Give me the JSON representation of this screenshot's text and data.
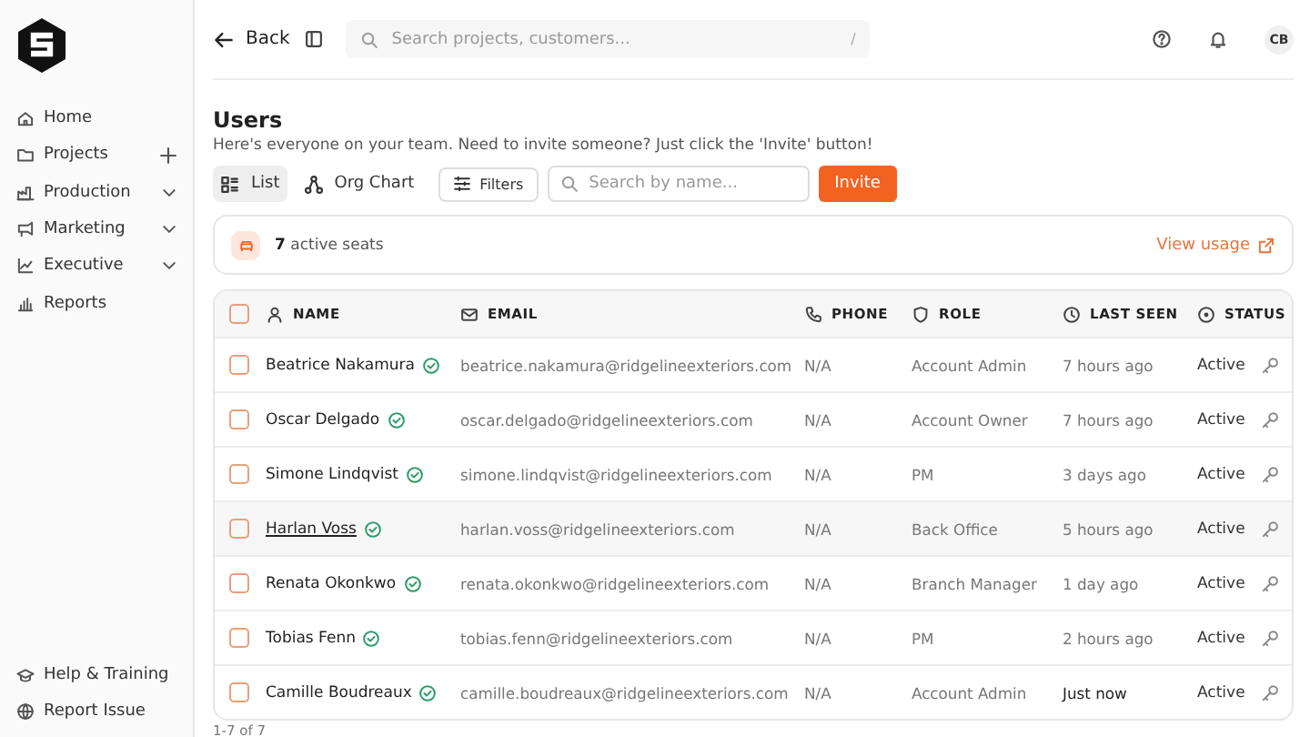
{
  "sidebar": {
    "items": [
      {
        "label": "Home",
        "kind": "link",
        "selected": false
      },
      {
        "label": "Projects",
        "kind": "addable",
        "selected": false
      },
      {
        "label": "Production",
        "kind": "group",
        "selected": false
      },
      {
        "label": "Marketing",
        "kind": "group",
        "selected": false
      },
      {
        "label": "Executive",
        "kind": "group",
        "selected": false
      },
      {
        "label": "Reports",
        "kind": "link",
        "selected": false
      }
    ],
    "footer_items": [
      {
        "label": "Help & Training"
      },
      {
        "label": "Report Issue"
      }
    ]
  },
  "topbar": {
    "back": "Back",
    "search": {
      "placeholder": "Search projects, customers...",
      "shortcut": "/"
    },
    "avatar": "CB"
  },
  "page": {
    "title": "Users",
    "subtitle": "Here's everyone on your team. Need to invite someone? Just click the 'Invite' button!",
    "views": [
      {
        "label": "List",
        "selected": true
      },
      {
        "label": "Org Chart",
        "selected": false
      }
    ],
    "filters": "Filters",
    "search": {
      "placeholder": "Search by name..."
    },
    "invite": "Invite"
  },
  "seats": {
    "count": "7",
    "label": "active seats",
    "link": "View usage"
  },
  "table": {
    "all_checked": false,
    "columns": [
      {
        "label": "NAME"
      },
      {
        "label": "EMAIL"
      },
      {
        "label": "PHONE"
      },
      {
        "label": "ROLE"
      },
      {
        "label": "LAST SEEN"
      },
      {
        "label": "STATUS"
      }
    ],
    "rows": [
      {
        "name": "Beatrice Nakamura",
        "verified": true,
        "email": "beatrice.nakamura@ridgelineexteriors.com",
        "phone": "N/A",
        "role": "Account Admin",
        "last_seen": "7 hours ago",
        "recent": false,
        "status": "Active",
        "checked": false,
        "highlighted": false
      },
      {
        "name": "Oscar Delgado",
        "verified": true,
        "email": "oscar.delgado@ridgelineexteriors.com",
        "phone": "N/A",
        "role": "Account Owner",
        "last_seen": "7 hours ago",
        "recent": false,
        "status": "Active",
        "checked": false,
        "highlighted": false
      },
      {
        "name": "Simone Lindqvist",
        "verified": true,
        "email": "simone.lindqvist@ridgelineexteriors.com",
        "phone": "N/A",
        "role": "PM",
        "last_seen": "3 days ago",
        "recent": false,
        "status": "Active",
        "checked": false,
        "highlighted": false
      },
      {
        "name": "Harlan Voss",
        "verified": true,
        "email": "harlan.voss@ridgelineexteriors.com",
        "phone": "N/A",
        "role": "Back Office",
        "last_seen": "5 hours ago",
        "recent": false,
        "status": "Active",
        "checked": false,
        "highlighted": true
      },
      {
        "name": "Renata Okonkwo",
        "verified": true,
        "email": "renata.okonkwo@ridgelineexteriors.com",
        "phone": "N/A",
        "role": "Branch Manager",
        "last_seen": "1 day ago",
        "recent": false,
        "status": "Active",
        "checked": false,
        "highlighted": false
      },
      {
        "name": "Tobias Fenn",
        "verified": true,
        "email": "tobias.fenn@ridgelineexteriors.com",
        "phone": "N/A",
        "role": "PM",
        "last_seen": "2 hours ago",
        "recent": false,
        "status": "Active",
        "checked": false,
        "highlighted": false
      },
      {
        "name": "Camille Boudreaux",
        "verified": true,
        "email": "camille.boudreaux@ridgelineexteriors.com",
        "phone": "N/A",
        "role": "Account Admin",
        "last_seen": "Just now",
        "recent": true,
        "status": "Active",
        "checked": false,
        "highlighted": false
      }
    ],
    "pagination": "1-7 of 7"
  }
}
